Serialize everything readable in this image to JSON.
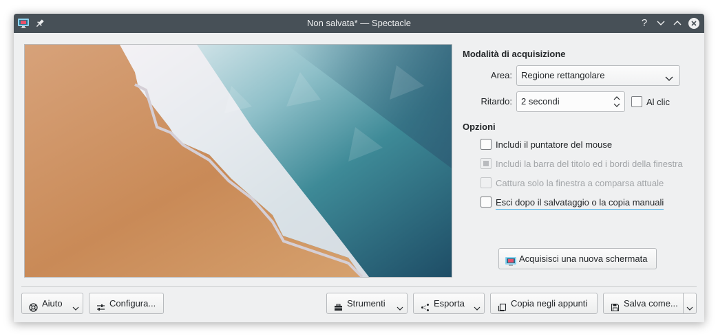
{
  "window": {
    "title": "Non salvata* — Spectacle"
  },
  "titlebar": {
    "icons": [
      "spectacle-app-icon",
      "pin-icon"
    ],
    "buttons": [
      "help-icon",
      "minimize-icon",
      "maximize-icon",
      "close-icon"
    ],
    "help_glyph": "?"
  },
  "capture": {
    "heading": "Modalità di acquisizione",
    "area_label": "Area:",
    "area_value": "Regione rettangolare",
    "delay_label": "Ritardo:",
    "delay_value": "2 secondi",
    "on_click_label": "Al clic",
    "on_click_checked": false
  },
  "options": {
    "heading": "Opzioni",
    "items": [
      {
        "label": "Includi il puntatore del mouse",
        "checked": false,
        "enabled": true
      },
      {
        "label": "Includi la barra del titolo ed i bordi della finestra",
        "checked": "partial",
        "enabled": false
      },
      {
        "label": "Cattura solo la finestra a comparsa attuale",
        "checked": false,
        "enabled": false
      },
      {
        "label": "Esci dopo il salvataggio o la copia manuali",
        "checked": false,
        "enabled": true,
        "focused": true
      }
    ]
  },
  "new_capture_button": "Acquisisci una nuova schermata",
  "footer": {
    "help": "Aiuto",
    "configure": "Configura...",
    "tools": "Strumenti",
    "export": "Esporta",
    "copy": "Copia negli appunti",
    "save_as": "Salva come..."
  },
  "colors": {
    "titlebar": "#475057",
    "window_bg": "#eff0f1",
    "focus_accent": "#3daee9",
    "preview_sand": "#c98a57",
    "preview_water": "#3e8a97"
  }
}
